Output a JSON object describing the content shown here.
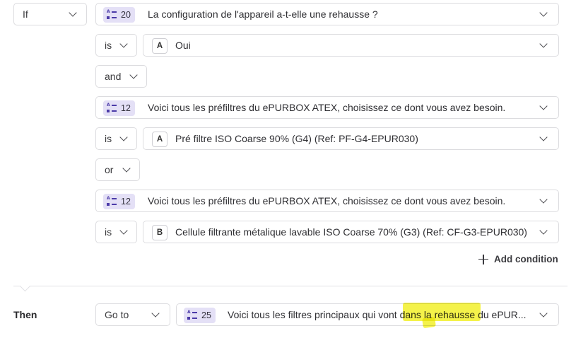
{
  "if_row": {
    "label": "If"
  },
  "conditions": [
    {
      "question_number": "20",
      "question_text": "La configuration de l'appareil a-t-elle une rehausse ?",
      "operator": "is",
      "answer_letter": "A",
      "answer_text": "Oui"
    },
    {
      "question_number": "12",
      "question_text": "Voici tous les préfiltres du ePURBOX ATEX, choisissez ce dont vous avez besoin.",
      "operator": "is",
      "answer_letter": "A",
      "answer_text": "Pré filtre ISO Coarse 90% (G4) (Ref: PF-G4-EPUR030)"
    },
    {
      "question_number": "12",
      "question_text": "Voici tous les préfiltres du ePURBOX ATEX, choisissez ce dont vous avez besoin.",
      "operator": "is",
      "answer_letter": "B",
      "answer_text": "Cellule filtrante métalique lavable ISO Coarse 70% (G3) (Ref: CF-G3-EPUR030)"
    }
  ],
  "connectors": [
    "and",
    "or"
  ],
  "add_condition_label": "Add condition",
  "then_row": {
    "label": "Then",
    "action": "Go to",
    "target_number": "25",
    "target_text": "Voici tous les filtres principaux qui vont dans la rehausse du ePUR..."
  },
  "colors": {
    "badge_bg": "#e4e0f6",
    "badge_icon": "#4b3aa8",
    "highlight": "#f3f02a",
    "border": "#dcdcdf"
  }
}
